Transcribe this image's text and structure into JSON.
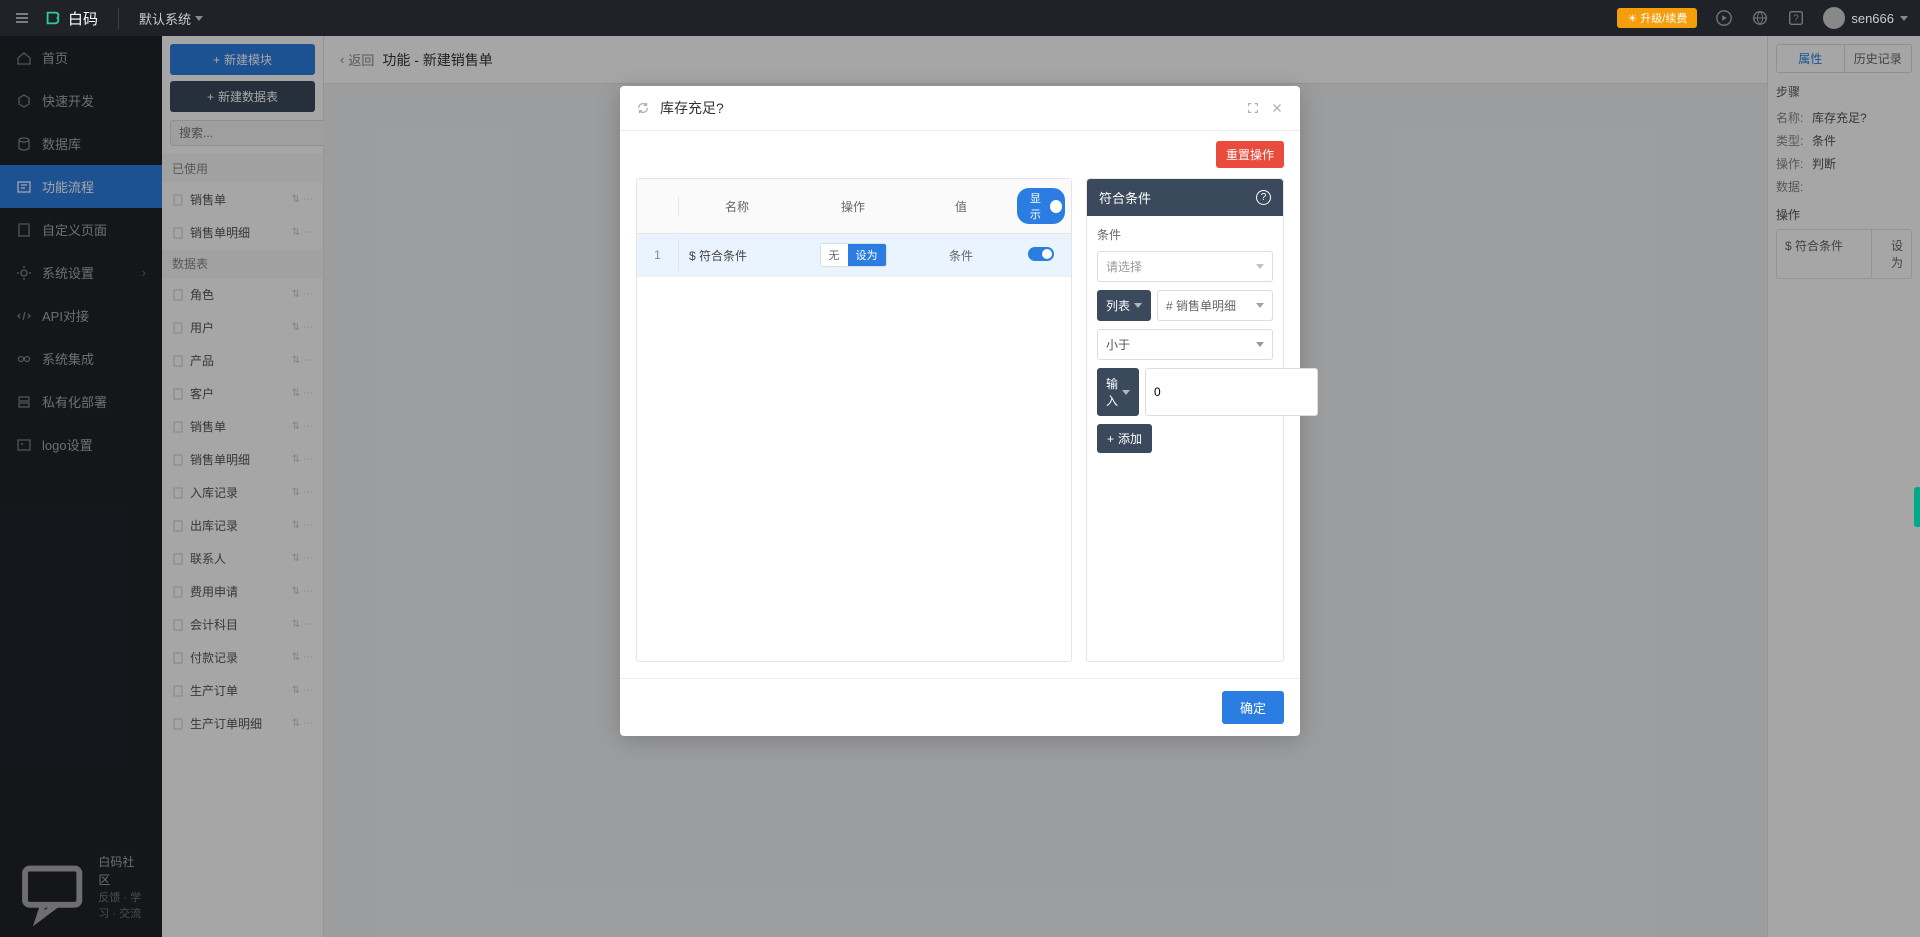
{
  "header": {
    "logo_text": "白码",
    "system_select": "默认系统",
    "upgrade": "升级/续费",
    "username": "sen666"
  },
  "nav": {
    "items": [
      {
        "label": "首页"
      },
      {
        "label": "快速开发"
      },
      {
        "label": "数据库"
      },
      {
        "label": "功能流程"
      },
      {
        "label": "自定义页面"
      },
      {
        "label": "系统设置"
      },
      {
        "label": "API对接"
      },
      {
        "label": "系统集成"
      },
      {
        "label": "私有化部署"
      },
      {
        "label": "logo设置"
      }
    ],
    "footer_title": "白码社区",
    "footer_sub": "反馈 · 学习 · 交流"
  },
  "module_panel": {
    "btn_new_module": "新建模块",
    "btn_new_table": "新建数据表",
    "search_placeholder": "搜索...",
    "section_used": "已使用",
    "used_items": [
      {
        "label": "销售单"
      },
      {
        "label": "销售单明细"
      }
    ],
    "section_tables": "数据表",
    "tables": [
      {
        "label": "角色"
      },
      {
        "label": "用户"
      },
      {
        "label": "产品"
      },
      {
        "label": "客户"
      },
      {
        "label": "销售单"
      },
      {
        "label": "销售单明细"
      },
      {
        "label": "入库记录"
      },
      {
        "label": "出库记录"
      },
      {
        "label": "联系人"
      },
      {
        "label": "费用申请"
      },
      {
        "label": "会计科目"
      },
      {
        "label": "付款记录"
      },
      {
        "label": "生产订单"
      },
      {
        "label": "生产订单明细"
      }
    ]
  },
  "workspace": {
    "back": "返回",
    "title": "功能 - 新建销售单"
  },
  "props": {
    "tab_attr": "属性",
    "tab_history": "历史记录",
    "section_step": "步骤",
    "rows": {
      "name_label": "名称:",
      "name_value": "库存充足?",
      "type_label": "类型:",
      "type_value": "条件",
      "op_label": "操作:",
      "op_value": "判断",
      "data_label": "数据:"
    },
    "section_op": "操作",
    "action_name": "$ 符合条件",
    "action_do": "设为"
  },
  "modal": {
    "title": "库存充足?",
    "btn_reset": "重置操作",
    "op_table": {
      "col_name": "名称",
      "col_action": "操作",
      "col_value": "值",
      "display_label": "显示",
      "row": {
        "idx": "1",
        "name": "$ 符合条件",
        "act_none": "无",
        "act_set": "设为",
        "value": "条件"
      }
    },
    "cond": {
      "header": "符合条件",
      "label_cond": "条件",
      "placeholder_select": "请选择",
      "list_label": "列表",
      "tag_label": "# 销售单明细",
      "operator": "小于",
      "input_label": "输入",
      "input_value": "0",
      "btn_add": "添加"
    },
    "btn_confirm": "确定"
  }
}
